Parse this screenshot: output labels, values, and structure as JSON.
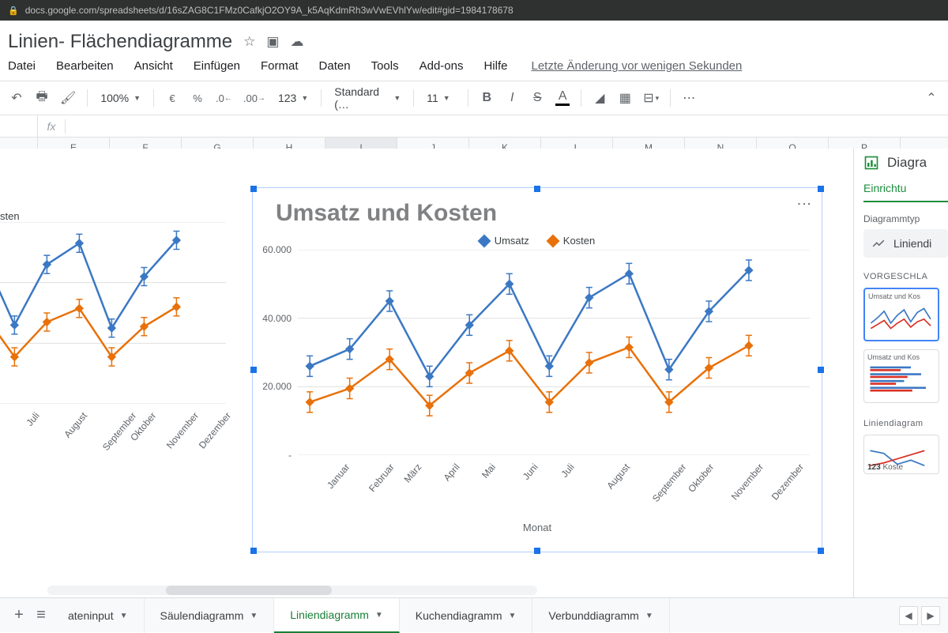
{
  "url": "docs.google.com/spreadsheets/d/16sZAG8C1FMz0CafkjO2OY9A_k5AqKdmRh3wVwEVhlYw/edit#gid=1984178678",
  "doc_title": "Linien- Flächendiagramme",
  "menus": [
    "Datei",
    "Bearbeiten",
    "Ansicht",
    "Einfügen",
    "Format",
    "Daten",
    "Tools",
    "Add-ons",
    "Hilfe"
  ],
  "last_edit": "Letzte Änderung vor wenigen Sekunden",
  "toolbar": {
    "zoom": "100%",
    "currency": "€",
    "percent": "%",
    "dec_dec": ".0",
    "dec_inc": ".00",
    "numfmt": "123",
    "font": "Standard (…",
    "fontsize": "11"
  },
  "columns": [
    "E",
    "F",
    "G",
    "H",
    "I",
    "J",
    "K",
    "L",
    "M",
    "N",
    "O",
    "P"
  ],
  "selected_col_index": 4,
  "side": {
    "title": "Diagra",
    "tab": "Einrichtu",
    "type_label": "Diagrammtyp",
    "type_value": "Liniendi",
    "section": "VORGESCHLA",
    "thumb_title": "Umsatz und Kos",
    "line_section": "Liniendiagram",
    "line_thumb_caption": "Koste"
  },
  "sheets": {
    "tabs": [
      {
        "label": "Dateninput",
        "trunc": "ateninput"
      },
      {
        "label": "Säulendiagramm"
      },
      {
        "label": "Liniendiagramm",
        "active": true
      },
      {
        "label": "Kuchendiagramm"
      },
      {
        "label": "Verbunddiagramm"
      }
    ]
  },
  "chart_left": {
    "title": "sten"
  },
  "chart_main": {
    "title": "Umsatz und Kosten",
    "legend": [
      "Umsatz",
      "Kosten"
    ],
    "xaxis": "Monat",
    "yticks": [
      "-",
      "20.000",
      "40.000",
      "60.000"
    ]
  },
  "chart_data": {
    "type": "line",
    "title": "Umsatz und Kosten",
    "xlabel": "Monat",
    "ylabel": "",
    "ylim": [
      0,
      60000
    ],
    "categories": [
      "Januar",
      "Februar",
      "März",
      "April",
      "Mai",
      "Juni",
      "Juli",
      "August",
      "September",
      "Oktober",
      "November",
      "Dezember"
    ],
    "series": [
      {
        "name": "Umsatz",
        "color": "#3b78c4",
        "values": [
          26000,
          31000,
          45000,
          23000,
          38000,
          50000,
          26000,
          46000,
          53000,
          25000,
          42000,
          54000
        ]
      },
      {
        "name": "Kosten",
        "color": "#e8710a",
        "values": [
          15500,
          19500,
          28000,
          14500,
          24000,
          30500,
          15500,
          27000,
          31500,
          15500,
          25500,
          32000
        ]
      }
    ],
    "error_bars": true
  }
}
